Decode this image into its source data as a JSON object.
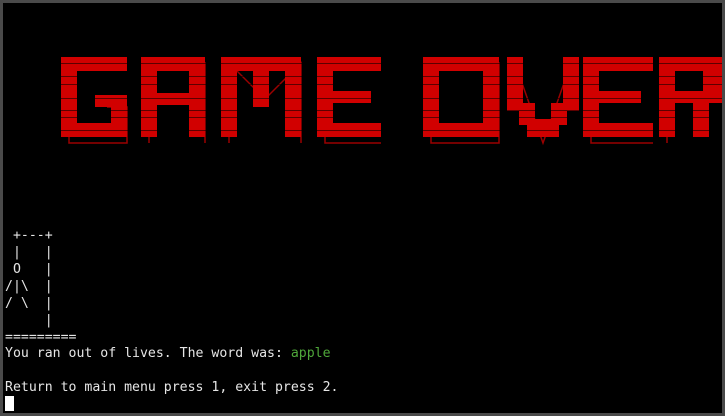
{
  "banner": {
    "text": "GAME OVER",
    "color": "#d10000",
    "outline_color": "#a00000"
  },
  "hangman": {
    "art": " +---+\n |   |\n O   |\n/|\\  |\n/ \\  |\n     |\n=========",
    "lines": [
      " +---+",
      " |   |",
      " O   |",
      "/|\\  |",
      "/ \\  |",
      "     |",
      "========="
    ]
  },
  "messages": {
    "lost_prefix": "You ran out of lives. The word was: ",
    "word": "apple",
    "word_color": "#4fa83a",
    "menu_prompt": "Return to main menu press 1, exit press 2."
  },
  "terminal": {
    "background": "#000000",
    "text_color": "#e6e6e6"
  }
}
